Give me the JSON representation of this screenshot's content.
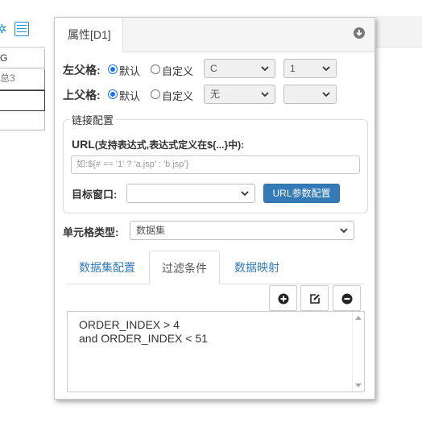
{
  "background": {
    "cells": [
      "G",
      "总3",
      "",
      ""
    ]
  },
  "panel": {
    "tab_title": "属性[D1]",
    "left_parent": {
      "label": "左父格:",
      "default_label": "默认",
      "custom_label": "自定义",
      "selected": "default",
      "col_value": "C",
      "row_value": "1"
    },
    "top_parent": {
      "label": "上父格:",
      "default_label": "默认",
      "custom_label": "自定义",
      "selected": "default",
      "col_value": "无",
      "row_value": ""
    },
    "link": {
      "legend": "链接配置",
      "url_label": "URL",
      "url_hint": "(支持表达式,表达式定义在${...}中):",
      "url_placeholder": "如:${# == '1' ? 'a.jsp' : 'b.jsp'}",
      "target_label": "目标窗口:",
      "target_value": "",
      "param_button": "URL参数配置"
    },
    "cell_type": {
      "label": "单元格类型:",
      "value": "数据集"
    },
    "subtabs": [
      {
        "label": "数据集配置",
        "active": false
      },
      {
        "label": "过滤条件",
        "active": true
      },
      {
        "label": "数据映射",
        "active": false
      }
    ],
    "toolbar": {
      "add_icon": "plus-circle-icon",
      "edit_icon": "edit-icon",
      "remove_icon": "minus-circle-icon"
    },
    "filter_lines": [
      "ORDER_INDEX > 4",
      "and ORDER_INDEX < 51"
    ]
  },
  "colors": {
    "accent": "#337ab7",
    "radio": "#1a73e8"
  }
}
